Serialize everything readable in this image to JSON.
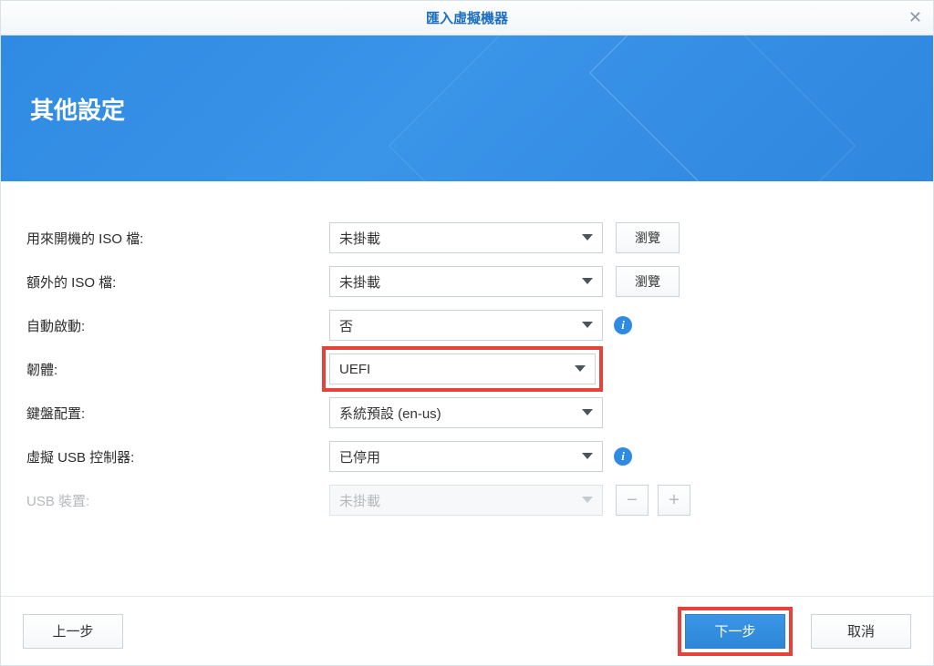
{
  "titlebar": {
    "title": "匯入虛擬機器"
  },
  "banner": {
    "title": "其他設定"
  },
  "fields": {
    "boot_iso": {
      "label": "用來開機的 ISO 檔:",
      "value": "未掛載",
      "browse": "瀏覽"
    },
    "extra_iso": {
      "label": "額外的 ISO 檔:",
      "value": "未掛載",
      "browse": "瀏覽"
    },
    "autostart": {
      "label": "自動啟動:",
      "value": "否"
    },
    "firmware": {
      "label": "韌體:",
      "value": "UEFI"
    },
    "keyboard": {
      "label": "鍵盤配置:",
      "value": "系統預設 (en-us)"
    },
    "usb_ctrl": {
      "label": "虛擬 USB 控制器:",
      "value": "已停用"
    },
    "usb_device": {
      "label": "USB 裝置:",
      "value": "未掛載"
    }
  },
  "footer": {
    "back": "上一步",
    "next": "下一步",
    "cancel": "取消"
  }
}
